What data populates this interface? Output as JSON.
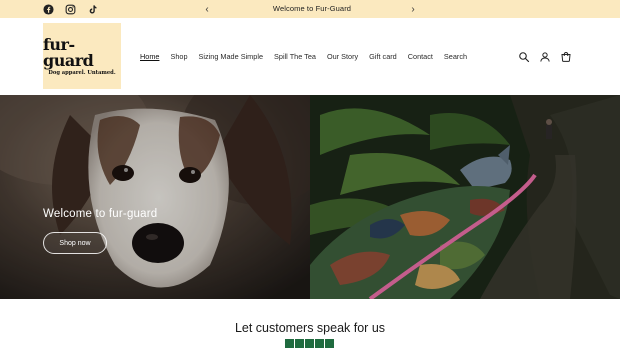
{
  "announcement": {
    "text": "Welcome to Fur-Guard",
    "prev_label": "‹",
    "next_label": "›"
  },
  "social": {
    "items": [
      {
        "name": "facebook-icon"
      },
      {
        "name": "instagram-icon"
      },
      {
        "name": "tiktok-icon"
      }
    ]
  },
  "brand": {
    "logo_main": "fur-guard",
    "logo_tagline": "Dog apparel. Untamed.",
    "logo_bg": "#fbe9bf"
  },
  "nav": {
    "items": [
      {
        "label": "Home",
        "active": true
      },
      {
        "label": "Shop"
      },
      {
        "label": "Sizing Made Simple"
      },
      {
        "label": "Spill The Tea"
      },
      {
        "label": "Our Story"
      },
      {
        "label": "Gift card"
      },
      {
        "label": "Contact"
      },
      {
        "label": "Search"
      }
    ]
  },
  "header_icons": [
    "search-icon",
    "account-icon",
    "cart-icon"
  ],
  "hero": {
    "title": "Welcome to fur-guard",
    "button_label": "Shop now"
  },
  "testimonials": {
    "title": "Let customers speak for us",
    "rating_color": "#1f6b3f"
  }
}
